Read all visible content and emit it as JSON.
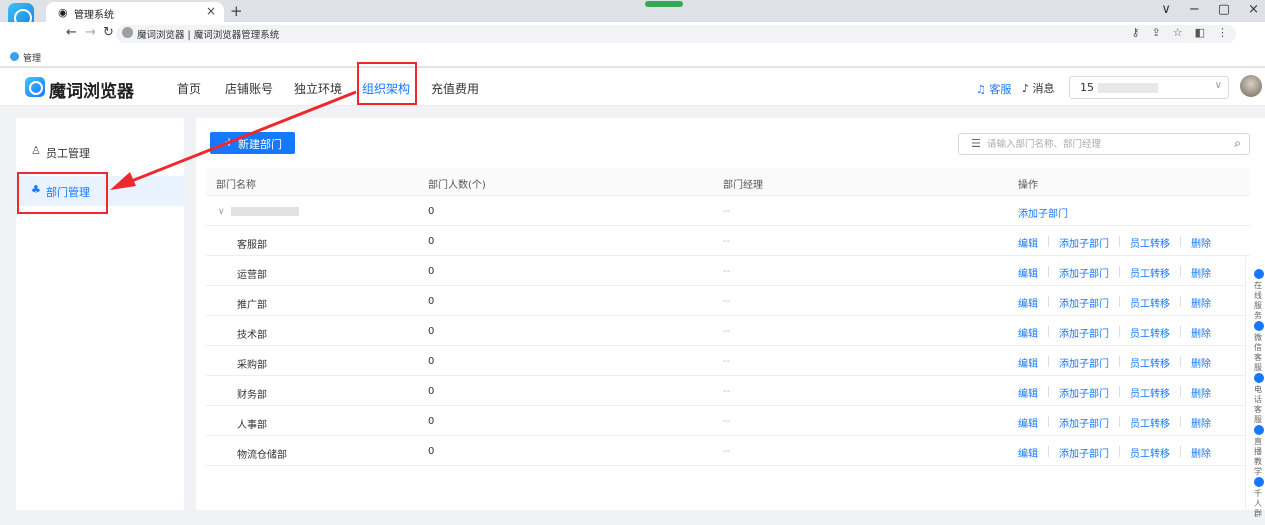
{
  "browser": {
    "tab_title": "管理系统",
    "tab_close": "×",
    "new_tab": "+",
    "url_text": "魔词浏览器 | 魔词浏览器管理系统",
    "bookmark_label": "管理",
    "window_controls": [
      "∨",
      "−",
      "▢",
      "×"
    ]
  },
  "header": {
    "brand": "魔词浏览器",
    "nav": [
      "首页",
      "店铺账号",
      "独立环境",
      "组织架构",
      "充值费用"
    ],
    "active_nav": "组织架构",
    "service": "客服",
    "messages": "消息",
    "account_value": "15"
  },
  "sidebar": {
    "items": [
      {
        "label": "员工管理",
        "icon": "user-icon"
      },
      {
        "label": "部门管理",
        "icon": "org-tree-icon"
      }
    ]
  },
  "toolbar": {
    "new_dept_label": "新建部门",
    "search_placeholder": "请输入部门名称、部门经理"
  },
  "table": {
    "headers": [
      "部门名称",
      "部门人数(个)",
      "部门经理",
      "操作"
    ],
    "root": {
      "count": "0",
      "manager": "--",
      "ops": [
        "添加子部门"
      ]
    },
    "rows": [
      {
        "name": "客服部",
        "count": "0",
        "manager": "--"
      },
      {
        "name": "运营部",
        "count": "0",
        "manager": "--"
      },
      {
        "name": "推广部",
        "count": "0",
        "manager": "--"
      },
      {
        "name": "技术部",
        "count": "0",
        "manager": "--"
      },
      {
        "name": "采购部",
        "count": "0",
        "manager": "--"
      },
      {
        "name": "财务部",
        "count": "0",
        "manager": "--"
      },
      {
        "name": "人事部",
        "count": "0",
        "manager": "--"
      },
      {
        "name": "物流仓储部",
        "count": "0",
        "manager": "--"
      }
    ],
    "row_ops": [
      "编辑",
      "添加子部门",
      "员工转移",
      "删除"
    ]
  },
  "float_bar": [
    {
      "label": "在线服务"
    },
    {
      "label": "微信客服"
    },
    {
      "label": "电话客服"
    },
    {
      "label": "直播教学"
    },
    {
      "label": "千人群"
    }
  ],
  "colors": {
    "accent": "#1677ff",
    "annotation": "#f0282d"
  }
}
